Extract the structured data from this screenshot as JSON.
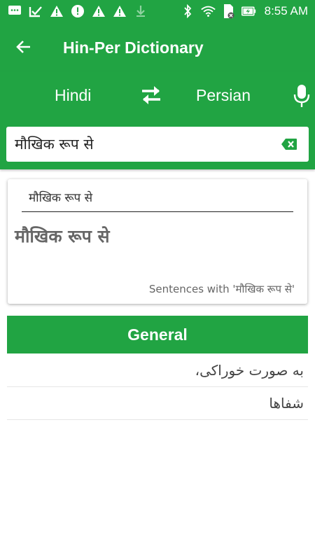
{
  "status_bar": {
    "time": "8:55 AM",
    "left_icons": [
      "messages-icon",
      "task-check-icon",
      "warning-icon",
      "alert-icon",
      "warning-icon",
      "warning-icon",
      "download-icon"
    ],
    "right_icons": [
      "bluetooth-icon",
      "wifi-icon",
      "sim-icon",
      "battery-charging-icon"
    ]
  },
  "app_bar": {
    "title": "Hin-Per Dictionary"
  },
  "language_bar": {
    "source_lang": "Hindi",
    "target_lang": "Persian"
  },
  "search": {
    "value": "मौखिक रूप से"
  },
  "card": {
    "heading": "मौखिक रूप से",
    "word": "मौखिक रूप से",
    "sentences_link": "Sentences with 'मौखिक रूप से'"
  },
  "section": {
    "title": "General"
  },
  "results": [
    "به صورت خوراکی،",
    "شفاها"
  ],
  "colors": {
    "primary": "#21a443",
    "text": "#444444"
  }
}
